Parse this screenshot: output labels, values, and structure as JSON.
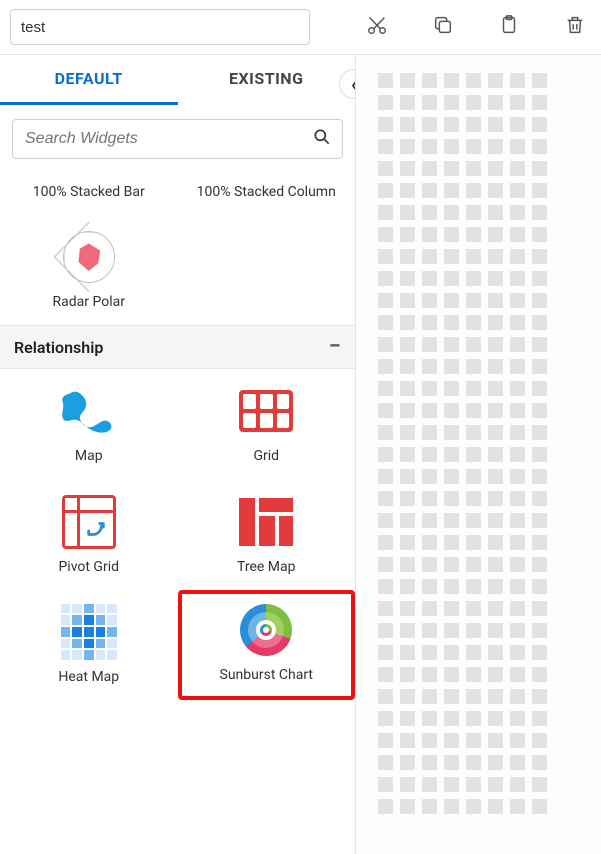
{
  "toolbar": {
    "title_value": "test"
  },
  "icons": {
    "cut": "cut-icon",
    "copy": "copy-icon",
    "paste": "paste-icon",
    "delete": "delete-icon",
    "collapse": "chevron-left-icon",
    "search": "search-icon"
  },
  "tabs": {
    "default": "DEFAULT",
    "existing": "EXISTING"
  },
  "search": {
    "placeholder": "Search Widgets"
  },
  "top_widgets": {
    "0": {
      "label": "100% Stacked Bar"
    },
    "1": {
      "label": "100% Stacked Column"
    },
    "2": {
      "label": "Radar Polar"
    }
  },
  "section": {
    "title": "Relationship",
    "state": "−"
  },
  "widgets": {
    "map": {
      "label": "Map"
    },
    "grid": {
      "label": "Grid"
    },
    "pivot": {
      "label": "Pivot Grid"
    },
    "treemap": {
      "label": "Tree Map"
    },
    "heatmap": {
      "label": "Heat Map"
    },
    "sunburst": {
      "label": "Sunburst Chart"
    }
  }
}
